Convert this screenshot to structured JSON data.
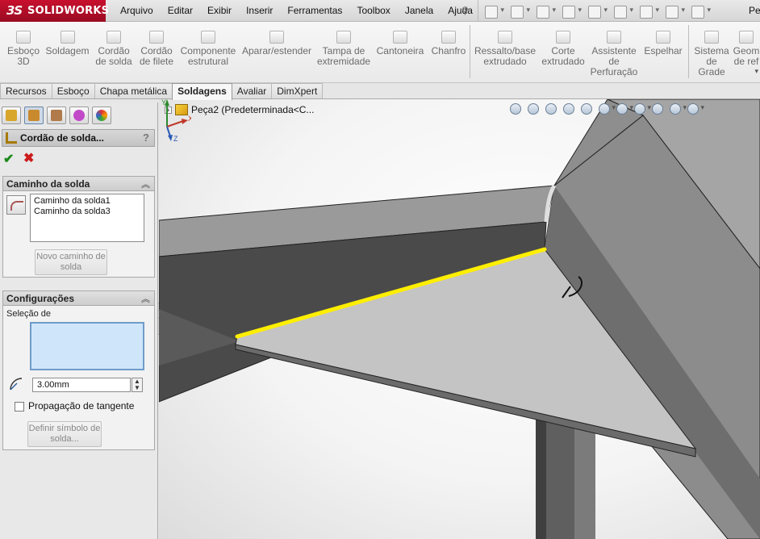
{
  "app": {
    "logo_ds": "3S",
    "logo_name": "SOLIDWORKS",
    "menu": [
      "Arquivo",
      "Editar",
      "Exibir",
      "Inserir",
      "Ferramentas",
      "Toolbox",
      "Janela",
      "Ajuda"
    ],
    "user_stub": "Pe"
  },
  "ribbon": {
    "buttons": [
      {
        "label": "Esboço 3D",
        "icon": "sketch-3d-icon"
      },
      {
        "label": "Soldagem",
        "icon": "weldment-icon"
      },
      {
        "label": "Cordão de solda",
        "icon": "weld-bead-icon"
      },
      {
        "label": "Cordão de filete",
        "icon": "fillet-bead-icon"
      },
      {
        "label": "Componente estrutural",
        "icon": "structural-member-icon"
      },
      {
        "label": "Aparar/estender",
        "icon": "trim-extend-icon"
      },
      {
        "label": "Tampa de extremidade",
        "icon": "end-cap-icon"
      },
      {
        "label": "Cantoneira",
        "icon": "gusset-icon"
      },
      {
        "label": "Chanfro",
        "icon": "chamfer-icon"
      },
      {
        "label": "Ressalto/base extrudado",
        "icon": "extruded-boss-icon"
      },
      {
        "label": "Corte extrudado",
        "icon": "extruded-cut-icon"
      },
      {
        "label": "Assistente de Perfuração",
        "icon": "hole-wizard-icon"
      },
      {
        "label": "Espelhar",
        "icon": "mirror-icon"
      },
      {
        "label": "Sistema de Grade",
        "icon": "grid-system-icon"
      },
      {
        "label": "Geom de ref",
        "icon": "reference-geometry-icon"
      }
    ]
  },
  "tabs": [
    "Recursos",
    "Esboço",
    "Chapa metálica",
    "Soldagens",
    "Avaliar",
    "DimXpert"
  ],
  "active_tab": "Soldagens",
  "property_manager": {
    "title": "Cordão de solda...",
    "help": "?",
    "weld_path_group": {
      "title": "Caminho da solda",
      "items": [
        "Caminho da solda1",
        "Caminho da solda3"
      ],
      "new_path_button": "Novo caminho de solda"
    },
    "settings_group": {
      "title": "Configurações",
      "selection_label": "Seleção de",
      "bead_size": "3.00mm",
      "tangent_propagation_label": "Propagação de tangente",
      "tangent_propagation_checked": false,
      "define_symbol_button": "Definir símbolo de solda..."
    }
  },
  "viewport": {
    "tree_item": "Peça2  (Predeterminada<C...",
    "weld_highlight_color": "#ffee00"
  }
}
